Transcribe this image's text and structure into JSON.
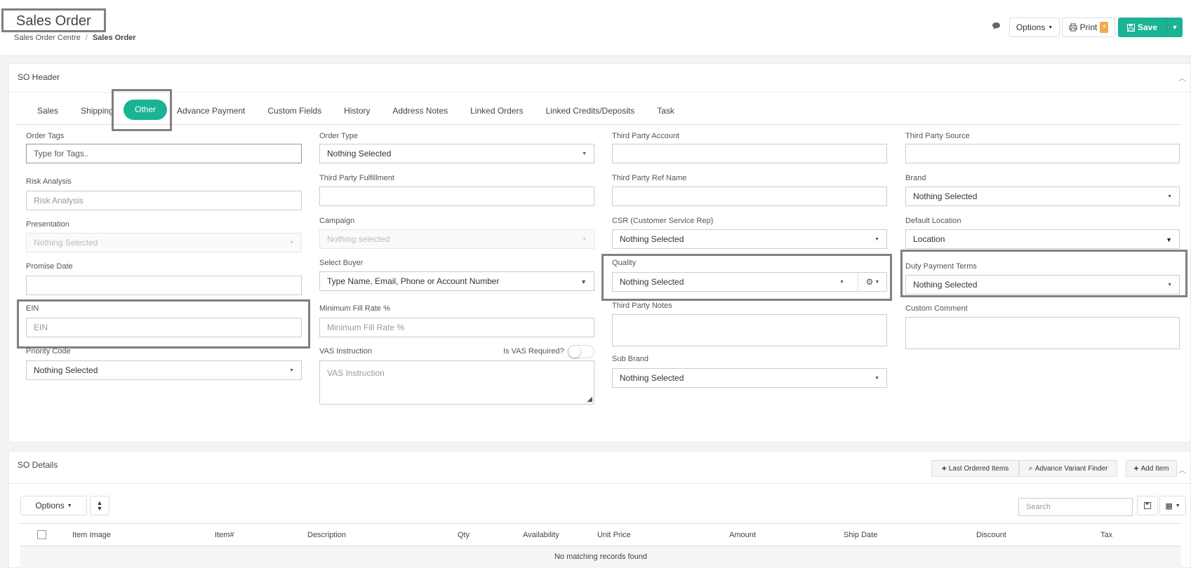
{
  "header": {
    "title": "Sales Order",
    "breadcrumb": [
      "Sales Order Centre",
      "Sales Order"
    ],
    "options_label": "Options",
    "print_label": "Print",
    "save_label": "Save"
  },
  "so_header": {
    "title": "SO Header",
    "tabs": [
      "Sales",
      "Shipping",
      "Other",
      "Advance Payment",
      "Custom Fields",
      "History",
      "Address Notes",
      "Linked Orders",
      "Linked Credits/Deposits",
      "Task"
    ],
    "active_tab": "Other"
  },
  "fields": {
    "order_tags": {
      "label": "Order Tags",
      "placeholder": "Type for Tags.."
    },
    "risk_analysis": {
      "label": "Risk Analysis",
      "placeholder": "Risk Analysis"
    },
    "presentation": {
      "label": "Presentation",
      "value": "Nothing Selected"
    },
    "promise_date": {
      "label": "Promise Date",
      "value": ""
    },
    "ein": {
      "label": "EIN",
      "placeholder": "EIN"
    },
    "priority_code": {
      "label": "Priority Code",
      "value": "Nothing Selected"
    },
    "order_type": {
      "label": "Order Type",
      "value": "Nothing Selected"
    },
    "third_party_fulfillment": {
      "label": "Third Party Fulfillment",
      "value": ""
    },
    "campaign": {
      "label": "Campaign",
      "value": "Nothing selected"
    },
    "select_buyer": {
      "label": "Select Buyer",
      "value": "Type Name, Email, Phone or Account Number"
    },
    "minimum_fill_rate": {
      "label": "Minimum Fill Rate %",
      "placeholder": "Minimum Fill Rate %"
    },
    "vas_instruction": {
      "label": "VAS Instruction",
      "placeholder": "VAS Instruction",
      "toggle_label": "Is VAS Required?"
    },
    "third_party_account": {
      "label": "Third Party Account",
      "value": ""
    },
    "third_party_ref_name": {
      "label": "Third Party Ref Name",
      "value": ""
    },
    "csr": {
      "label": "CSR (Customer Service Rep)",
      "value": "Nothing Selected"
    },
    "quality": {
      "label": "Quality",
      "value": "Nothing Selected"
    },
    "third_party_notes": {
      "label": "Third Party Notes",
      "value": ""
    },
    "sub_brand": {
      "label": "Sub Brand",
      "value": "Nothing Selected"
    },
    "third_party_source": {
      "label": "Third Party Source",
      "value": ""
    },
    "brand": {
      "label": "Brand",
      "value": "Nothing Selected"
    },
    "default_location": {
      "label": "Default Location",
      "value": "Location"
    },
    "duty_payment_terms": {
      "label": "Duty Payment Terms",
      "value": "Nothing Selected"
    },
    "custom_comment": {
      "label": "Custom Comment",
      "value": ""
    }
  },
  "so_details": {
    "title": "SO Details",
    "last_ordered_label": "Last Ordered Items",
    "advance_variant_label": "Advance Variant Finder",
    "add_item_label": "Add Item",
    "options_label": "Options",
    "search_placeholder": "Search",
    "columns": [
      "Item Image",
      "Item#",
      "Description",
      "Qty",
      "Availability",
      "Unit Price",
      "Amount",
      "Ship Date",
      "Discount",
      "Tax"
    ],
    "empty_message": "No matching records found"
  },
  "colors": {
    "accent": "#1ab394",
    "highlight_border": "#808080",
    "badge": "#f0ad4e"
  }
}
